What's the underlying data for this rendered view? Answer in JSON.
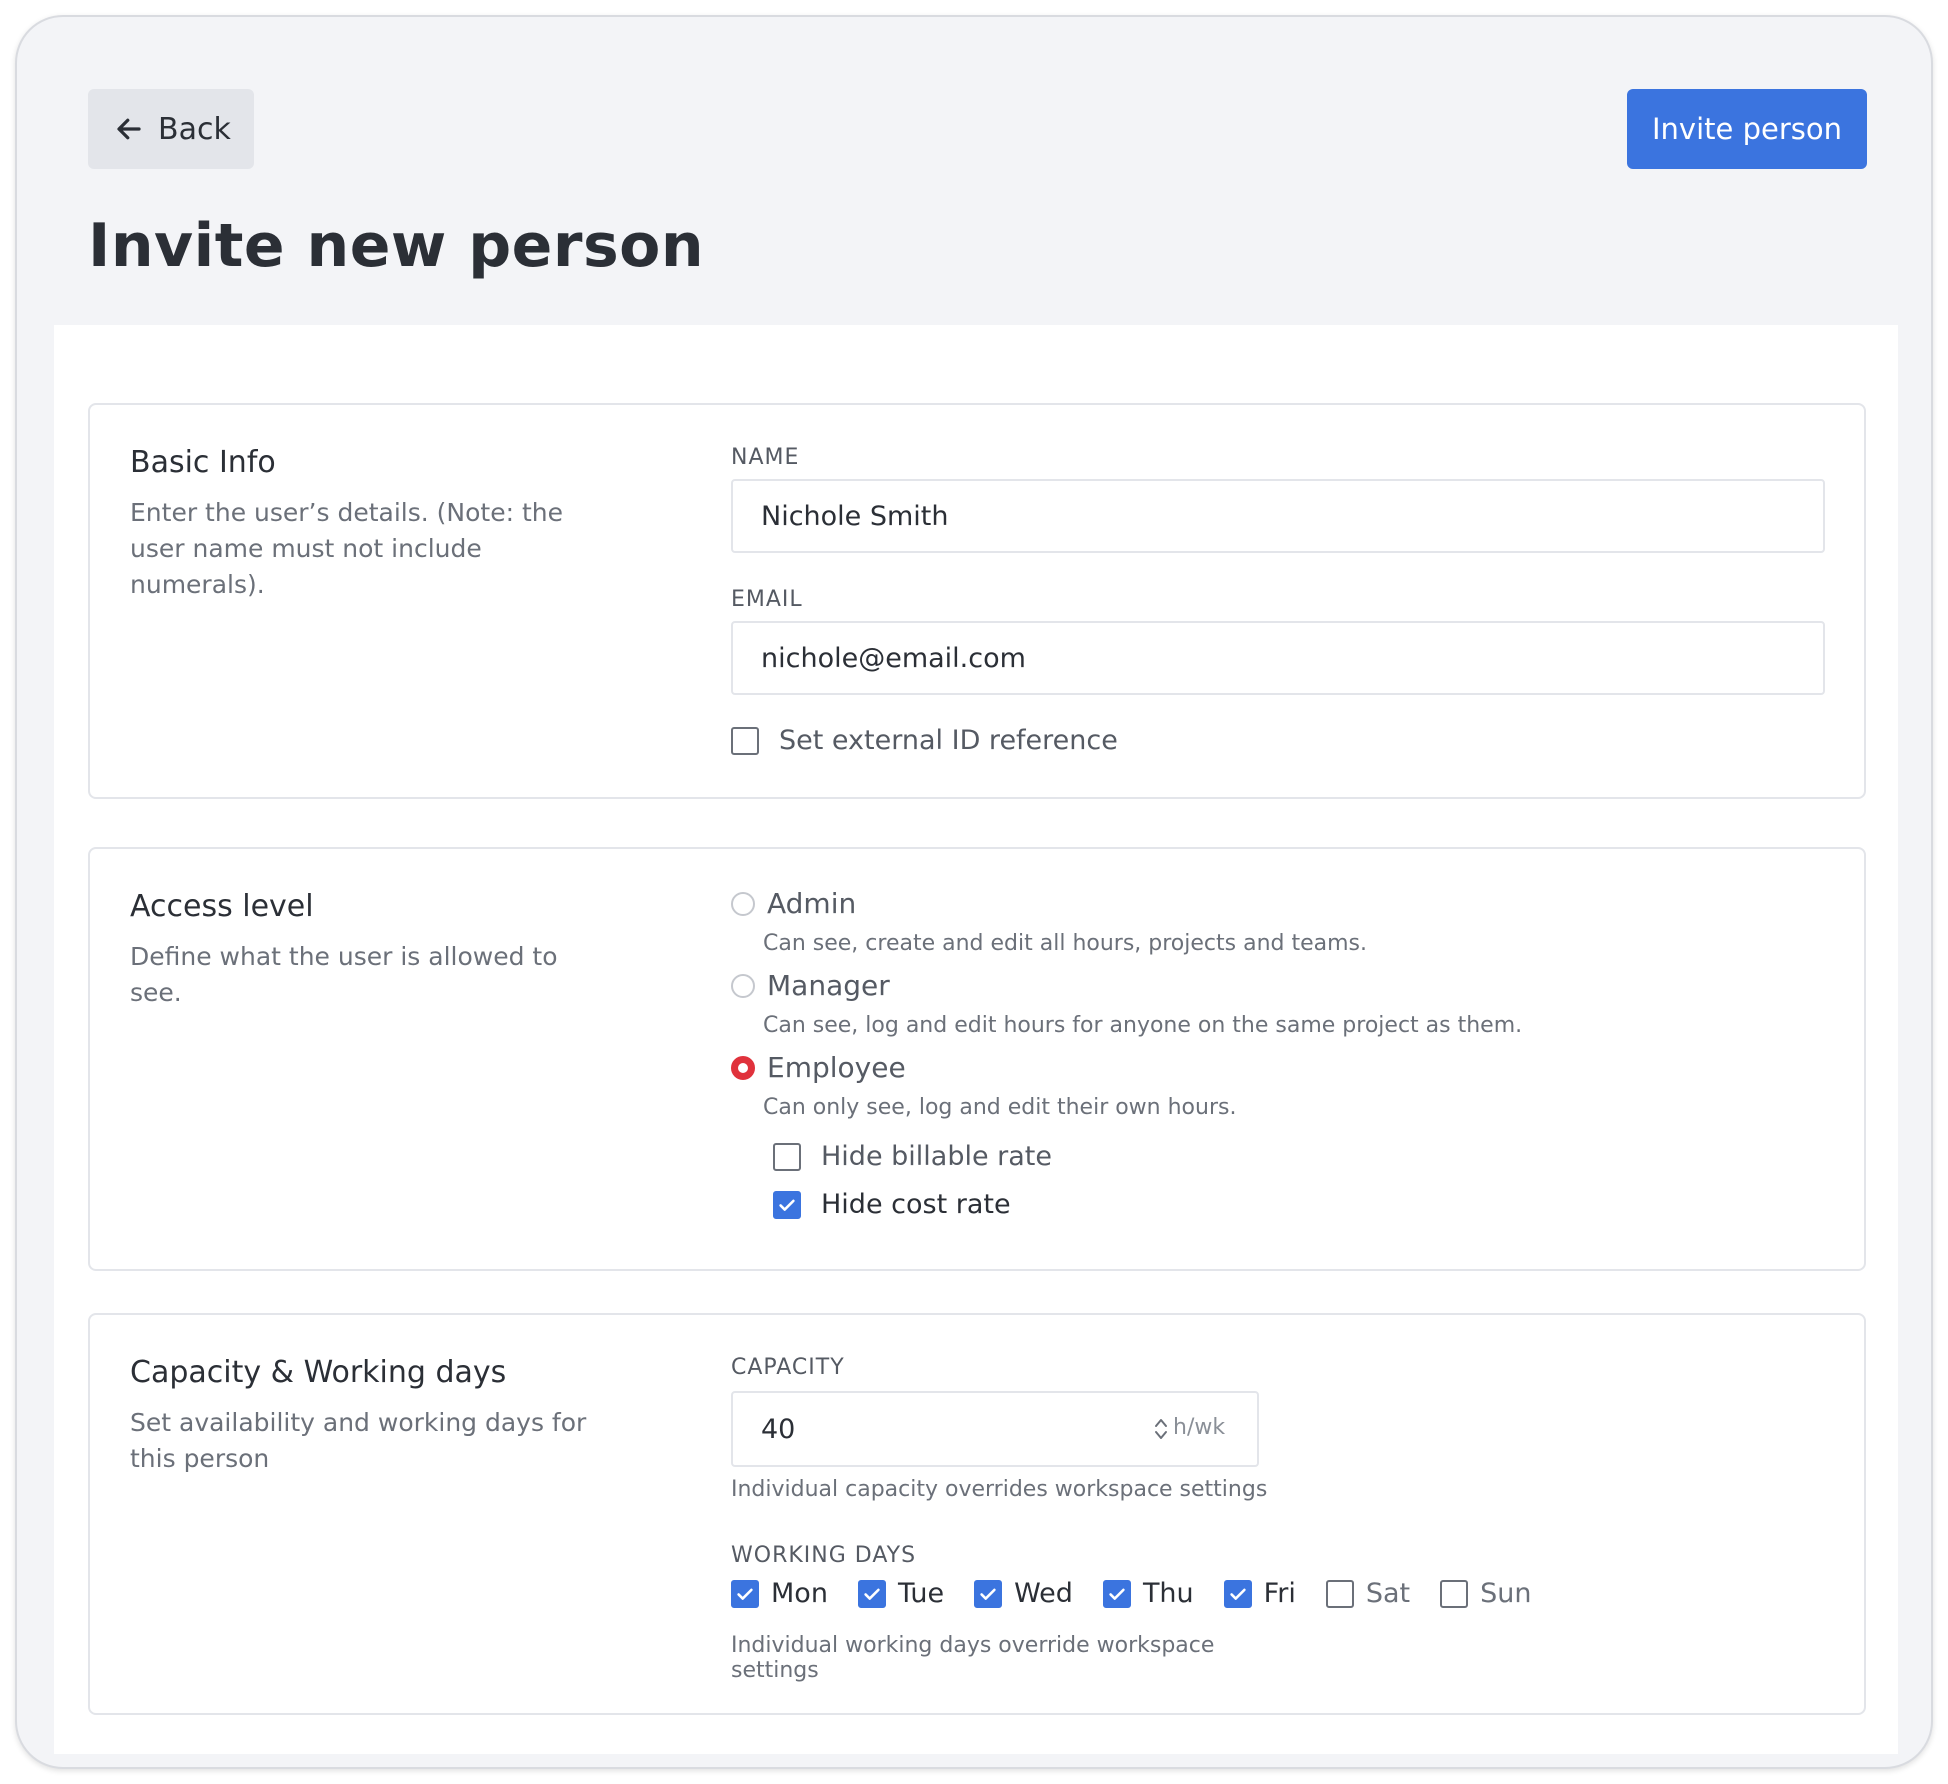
{
  "header": {
    "back_label": "Back",
    "invite_label": "Invite person",
    "title": "Invite new person"
  },
  "colors": {
    "primary": "#3b74df",
    "radio_selected": "#e0323c",
    "background": "#f3f4f7"
  },
  "basic_info": {
    "title": "Basic Info",
    "description": "Enter the user’s details. (Note: the user name must not include numerals).",
    "name_label": "NAME",
    "name_value": "Nichole Smith",
    "email_label": "EMAIL",
    "email_value": "nichole@email.com",
    "external_id_label": "Set external ID reference",
    "external_id_checked": false
  },
  "access_level": {
    "title": "Access level",
    "description": "Define what the user is allowed to see.",
    "options": [
      {
        "label": "Admin",
        "description": "Can see, create and edit all hours, projects and teams.",
        "selected": false
      },
      {
        "label": "Manager",
        "description": "Can see, log and edit hours for anyone on the same project as them.",
        "selected": false
      },
      {
        "label": "Employee",
        "description": "Can only see, log and edit their own hours.",
        "selected": true
      }
    ],
    "hide_billable_label": "Hide billable rate",
    "hide_billable_checked": false,
    "hide_cost_label": "Hide cost rate",
    "hide_cost_checked": true
  },
  "capacity": {
    "title": "Capacity & Working days",
    "description": "Set availability and working days for this person",
    "capacity_label": "CAPACITY",
    "capacity_value": "40",
    "unit": "h/wk",
    "capacity_help": "Individual capacity overrides workspace settings",
    "working_days_label": "WORKING DAYS",
    "days": [
      {
        "label": "Mon",
        "checked": true
      },
      {
        "label": "Tue",
        "checked": true
      },
      {
        "label": "Wed",
        "checked": true
      },
      {
        "label": "Thu",
        "checked": true
      },
      {
        "label": "Fri",
        "checked": true
      },
      {
        "label": "Sat",
        "checked": false
      },
      {
        "label": "Sun",
        "checked": false
      }
    ],
    "days_help": "Individual working days override workspace settings"
  }
}
